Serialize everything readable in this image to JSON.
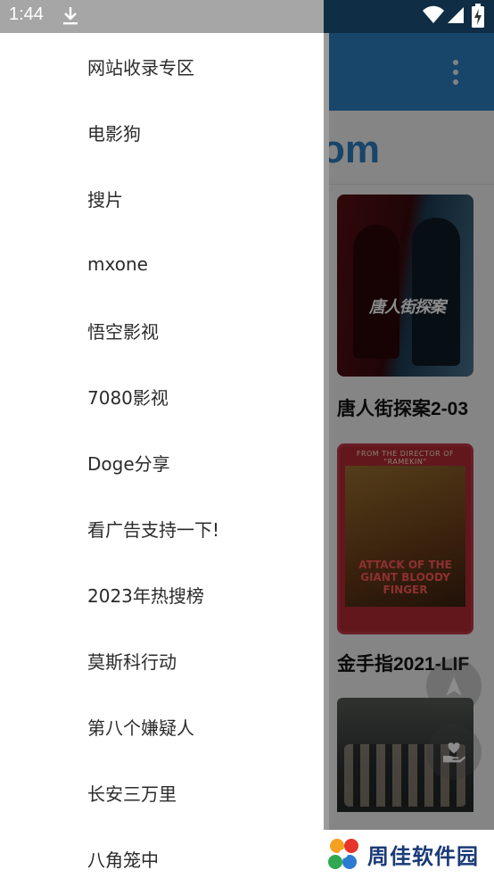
{
  "status_bar": {
    "time": "1:44",
    "icons": [
      "download-icon",
      "wifi-icon",
      "signal-icon",
      "battery-charging-icon"
    ]
  },
  "background_app": {
    "overflow_menu_icon": "more-vert-icon",
    "logo_fragment": "om",
    "movies": [
      {
        "title": "唐人街探案2-03",
        "poster_text": "唐人街探案"
      },
      {
        "title": "金手指2021-LIF",
        "poster_top_text": "FROM THE DIRECTOR OF \"RAMEKIN\"",
        "poster_bottom_text": "ATTACK OF THE GIANT BLOODY FINGER"
      },
      {
        "title": ""
      }
    ],
    "fab_icons": [
      "navigation-arrow-icon",
      "hand-heart-icon"
    ]
  },
  "drawer": {
    "items": [
      {
        "label": "网站收录专区"
      },
      {
        "label": "电影狗"
      },
      {
        "label": "搜片"
      },
      {
        "label": "mxone"
      },
      {
        "label": "悟空影视"
      },
      {
        "label": "7080影视"
      },
      {
        "label": "Doge分享"
      },
      {
        "label": "看广告支持一下!"
      },
      {
        "label": "2023年热搜榜"
      },
      {
        "label": "莫斯科行动"
      },
      {
        "label": "第八个嫌疑人"
      },
      {
        "label": "长安三万里"
      },
      {
        "label": "八角笼中"
      }
    ]
  },
  "watermark": {
    "text": "周佳软件园"
  },
  "colors": {
    "toolbar": "#2d7fc1",
    "drawer_bg": "#ffffff",
    "text": "#2b2b2b",
    "watermark_text": "#1a3a78"
  }
}
